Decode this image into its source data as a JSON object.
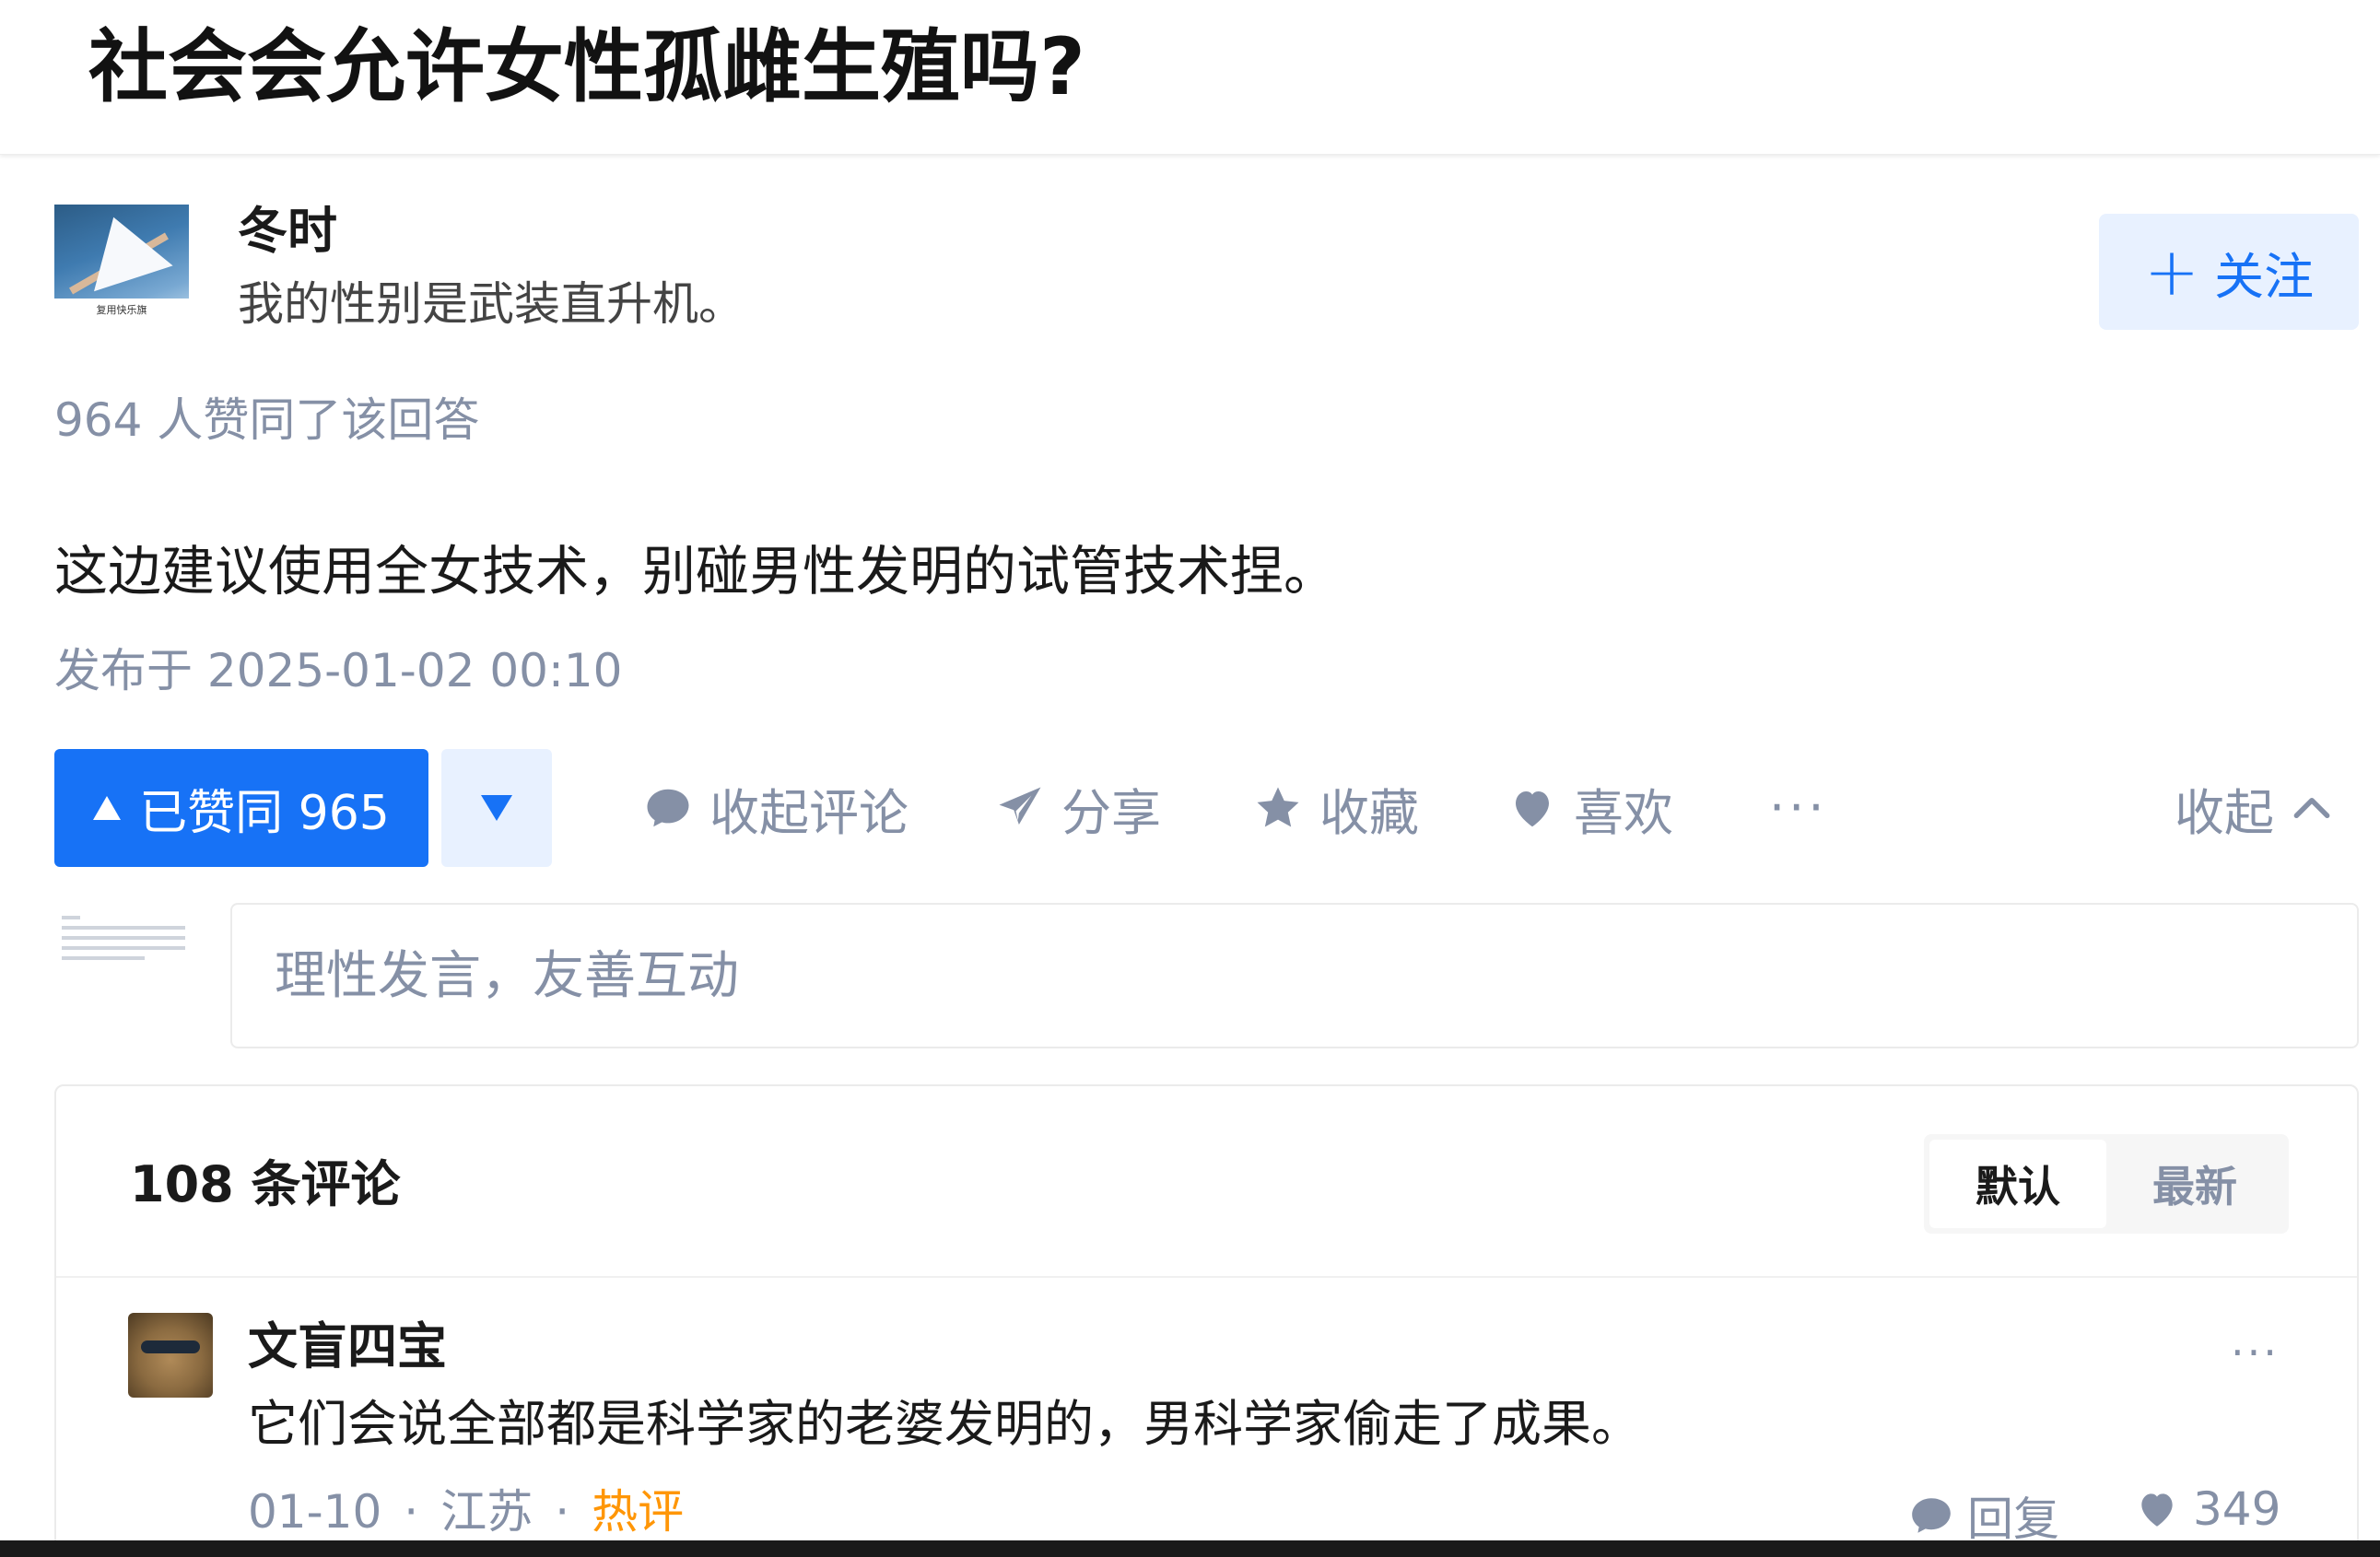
{
  "question": {
    "title": "社会会允许女性孤雌生殖吗?"
  },
  "author": {
    "name": "冬时",
    "bio": "我的性别是武装直升机。",
    "avatar_caption": "复用快乐旗",
    "follow_label": "关注"
  },
  "answer": {
    "vote_summary": "964 人赞同了该回答",
    "content": "这边建议使用全女技术，别碰男性发明的试管技术捏。",
    "published": "发布于 2025-01-02 00:10"
  },
  "actions": {
    "upvote_label": "已赞同 965",
    "collapse_comments": "收起评论",
    "share": "分享",
    "favorite": "收藏",
    "like": "喜欢",
    "more": "···",
    "collapse": "收起"
  },
  "comment_input": {
    "placeholder": "理性发言，友善互动"
  },
  "comments": {
    "count_label": "108 条评论",
    "sort_tabs": [
      "默认",
      "最新"
    ],
    "active_sort": "默认",
    "items": [
      {
        "author": "文盲四宝",
        "text": "它们会说全部都是科学家的老婆发明的，男科学家偷走了成果。",
        "date": "01-10",
        "location": "江苏",
        "tag": "热评",
        "reply_label": "回复",
        "likes": "349",
        "more": "···"
      }
    ]
  },
  "colors": {
    "accent": "#1772f6",
    "accent_light": "#e8f1ff",
    "muted": "#8590a6",
    "hot": "#ff9607"
  },
  "icons": [
    "plus-icon",
    "upvote-triangle-icon",
    "downvote-triangle-icon",
    "comment-bubble-icon",
    "paper-plane-icon",
    "star-icon",
    "heart-icon",
    "chevron-up-icon"
  ]
}
